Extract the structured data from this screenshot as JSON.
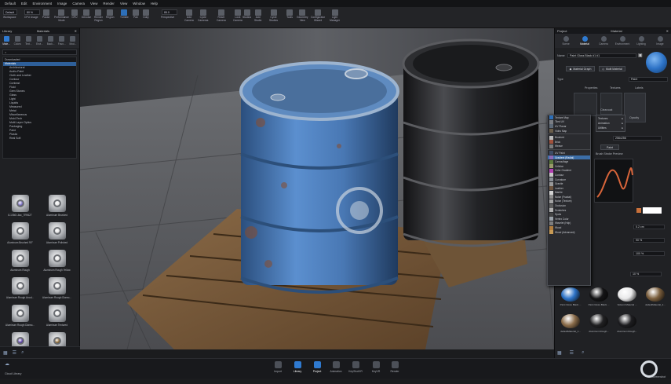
{
  "menu": [
    "Default",
    "Edit",
    "Environment",
    "Image",
    "Camera",
    "View",
    "Render",
    "View",
    "Window",
    "Help"
  ],
  "toolbar": {
    "workspace_value": "Default",
    "zoom_value": "80 %",
    "fov_value": "85.0",
    "items": [
      {
        "id": "workspace",
        "label": "Workspace"
      },
      {
        "id": "cpu",
        "label": "CPU Usage"
      },
      {
        "id": "pause",
        "label": "Pause"
      },
      {
        "id": "perf",
        "label": "Performance\nMode"
      },
      {
        "id": "gpu",
        "label": "GPU"
      },
      {
        "id": "denoise",
        "label": "Denoise"
      },
      {
        "id": "render_region",
        "label": "Render\nRegion"
      },
      {
        "id": "region",
        "label": "Region"
      },
      {
        "id": "tumble",
        "label": "Tumble"
      },
      {
        "id": "pan",
        "label": "Pan"
      },
      {
        "id": "dolly",
        "label": "Dolly"
      },
      {
        "id": "perspective",
        "label": "Perspective"
      },
      {
        "id": "add_camera",
        "label": "Add\nCamera"
      },
      {
        "id": "cycle_cameras",
        "label": "Cycle\nCameras"
      },
      {
        "id": "reset_camera",
        "label": "Reset\nCamera"
      },
      {
        "id": "lock_camera",
        "label": "Lock\nCamera"
      },
      {
        "id": "studios",
        "label": "Studios"
      },
      {
        "id": "add_studio",
        "label": "Add\nStudio"
      },
      {
        "id": "cycle_studios",
        "label": "Cycle\nStudios"
      },
      {
        "id": "tools",
        "label": "Tools"
      },
      {
        "id": "geometry_view",
        "label": "Geometry\nView"
      },
      {
        "id": "configurator",
        "label": "Configurator\nWizard"
      },
      {
        "id": "light_manager",
        "label": "Light\nManager"
      }
    ]
  },
  "library": {
    "title": "Library",
    "subtitle": "Materials",
    "tabs": [
      "Mate...",
      "Colors",
      "Text...",
      "Envi...",
      "Back...",
      "Favo...",
      "Mod..."
    ],
    "search_placeholder": "",
    "tree": [
      "Downloaded",
      "Materials",
      "Architectural",
      "Audio-Paint",
      "Cloth and Leather",
      "Contour",
      "Contrast",
      "Fluid",
      "Gem Stones",
      "Glass",
      "Light",
      "Liquids",
      "Measured",
      "Metal",
      "Miscellaneous",
      "Mold-Tech",
      "Multi Layer Optics",
      "Packaging",
      "Paint",
      "Plastic",
      "Real Soft"
    ],
    "selected_index": 1,
    "thumbs": [
      "8-1066 Lilac_7R9627",
      "Aluminum Brushed",
      "Aluminum Brushed 90°",
      "Aluminum Polished",
      "Aluminum Rough",
      "Aluminum Rough Yellow",
      "Aluminum Rough Anod...",
      "Aluminum Rough Diamo...",
      "Aluminum Rough Diamo...",
      "Aluminum Textured",
      "Amazing Grape_7H1R08",
      "Ammonium Brown_7H1H2",
      "",
      ""
    ],
    "thumb_colors": [
      "#7b6fc4",
      "#e6e6e6",
      "#e6e6e6",
      "#e6e6e6",
      "#e6e6e6",
      "#e6e6e6",
      "#e6e6e6",
      "#e6e6e6",
      "#e6e6e6",
      "#e6e6e6",
      "#5b3fa8",
      "#8c6a35",
      "#2a4fa0",
      "#9a9aa0"
    ],
    "bottom_label": "Cloud Library"
  },
  "project": {
    "title": "Project",
    "subtitle": "Material",
    "tabs": [
      "Scene",
      "Material",
      "Camera",
      "Environment",
      "Lighting",
      "Image"
    ],
    "name_label": "Name",
    "name_value": "Paint Gloss Black #1 #1",
    "graph_button": "Material Graph",
    "multi_button": "Multi Material",
    "type_label": "Type",
    "type_value": "Paint",
    "col_headers": [
      "Properties",
      "Textures",
      "Labels"
    ],
    "subtab_labels": [
      "Clearcoat",
      "Opacity"
    ],
    "sample_value": "256x256",
    "paint_button": "Paint",
    "brush_label": "Brush Stroke Preview",
    "size_value": "0.2 cm",
    "pct1": "90 %",
    "pct2": "100 %",
    "pct3": "10 %"
  },
  "context_menu": {
    "items": [
      "Texture Map",
      "Tiled UV",
      "UV Planar",
      "Video Map",
      "",
      "Brushed",
      "Brick",
      "Weave",
      "",
      "UV Paint",
      "Gradient (Radial)",
      "Camouflage",
      "Cellular",
      "Color Gradient",
      "Contour",
      "Curvature",
      "Granite",
      "Leather",
      "Marble",
      "Noise (Fractal)",
      "Noise (Texture)",
      "Occlusion",
      "Scratches",
      "Spots",
      "Vertex Color",
      "Wavelet (Hdp)",
      "Wood",
      "Wood (Advanced)"
    ],
    "swatches": [
      "#2d6fb8",
      "#7b7e84",
      "#5e6a78",
      "#6a5d4a",
      "",
      "#b9b9b9",
      "#a0523d",
      "#7b7b7b",
      "",
      "#3d4c66",
      "#8a6bb5",
      "#5d7a3e",
      "#9a9a6b",
      "#b13fb1",
      "#c8c8c8",
      "#8a8f96",
      "#9a9a9a",
      "#6d5540",
      "#d2d2d2",
      "#8d8d8d",
      "#a3a3a3",
      "#5e5e5e",
      "#b0b0b0",
      "#444444",
      "#9aa1a8",
      "#7d7d7d",
      "#b07d3e",
      "#c79a55"
    ],
    "highlight_index": 10
  },
  "submenu": [
    "Textures",
    "Animation",
    "Utilities"
  ],
  "swatches": [
    {
      "name": "Paint Gloss Black ...",
      "color": "#2d73c7"
    },
    {
      "name": "Paint Gloss Black ...",
      "color": "#141416"
    },
    {
      "name": "Solvent Material ...",
      "color": "#e9e9ea"
    },
    {
      "name": "defaultMaterial_1...",
      "color": "#7a5e3d"
    },
    {
      "name": "defaultMaterial_1...",
      "color": "#8a6c4a"
    },
    {
      "name": "Aluminum Rough...",
      "color": "#202022"
    },
    {
      "name": "Aluminum Rough...",
      "color": "#1d1d20"
    },
    {
      "name": "",
      "color": ""
    }
  ],
  "right_bottom_label": "Screenshot",
  "bottom_bar": [
    "Import",
    "Library",
    "Project",
    "Animation",
    "KeyShotXR",
    "KeyVR",
    "Render"
  ],
  "bottom_active": [
    1,
    2
  ]
}
